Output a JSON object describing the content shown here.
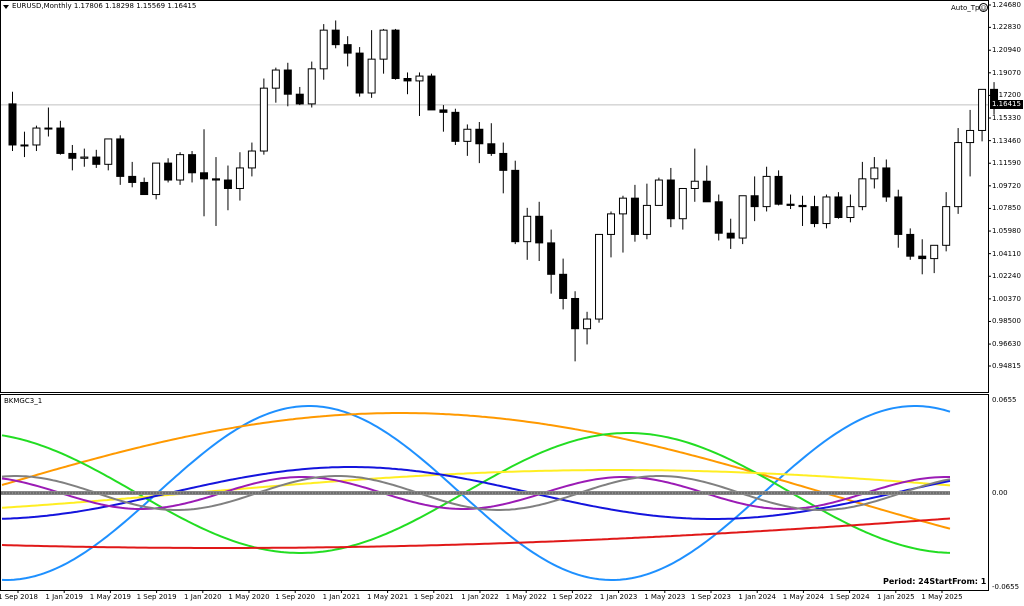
{
  "main_chart": {
    "symbol_info": "EURUSD,Monthly  1.17806 1.18298 1.15569 1.16415",
    "indicator_tag": "Auto_Tp",
    "current_price": "1.16415",
    "price_labels": [
      "1.24680",
      "1.22830",
      "1.20940",
      "1.19070",
      "1.17200",
      "1.15330",
      "1.13460",
      "1.11590",
      "1.09720",
      "1.07850",
      "1.05980",
      "1.04110",
      "1.02240",
      "1.00370",
      "0.98500",
      "0.96630",
      "0.94815"
    ],
    "price_range": [
      0.94815,
      1.2468
    ],
    "candles": [
      [
        1.165,
        1.175,
        1.126,
        1.131
      ],
      [
        1.131,
        1.142,
        1.121,
        1.131
      ],
      [
        1.131,
        1.147,
        1.126,
        1.145
      ],
      [
        1.145,
        1.162,
        1.138,
        1.145
      ],
      [
        1.145,
        1.151,
        1.123,
        1.124
      ],
      [
        1.124,
        1.131,
        1.11,
        1.12
      ],
      [
        1.12,
        1.128,
        1.113,
        1.121
      ],
      [
        1.121,
        1.127,
        1.112,
        1.115
      ],
      [
        1.115,
        1.136,
        1.11,
        1.136
      ],
      [
        1.136,
        1.139,
        1.098,
        1.105
      ],
      [
        1.105,
        1.117,
        1.096,
        1.1
      ],
      [
        1.1,
        1.104,
        1.09,
        1.09
      ],
      [
        1.09,
        1.116,
        1.086,
        1.116
      ],
      [
        1.116,
        1.12,
        1.1,
        1.102
      ],
      [
        1.102,
        1.125,
        1.098,
        1.123
      ],
      [
        1.123,
        1.126,
        1.1,
        1.108
      ],
      [
        1.108,
        1.144,
        1.072,
        1.103
      ],
      [
        1.103,
        1.121,
        1.064,
        1.102
      ],
      [
        1.102,
        1.114,
        1.077,
        1.095
      ],
      [
        1.095,
        1.125,
        1.085,
        1.112
      ],
      [
        1.112,
        1.133,
        1.105,
        1.126
      ],
      [
        1.126,
        1.186,
        1.123,
        1.178
      ],
      [
        1.178,
        1.195,
        1.166,
        1.193
      ],
      [
        1.193,
        1.199,
        1.163,
        1.173
      ],
      [
        1.173,
        1.179,
        1.164,
        1.165
      ],
      [
        1.165,
        1.2,
        1.162,
        1.194
      ],
      [
        1.194,
        1.231,
        1.185,
        1.226
      ],
      [
        1.226,
        1.234,
        1.211,
        1.214
      ],
      [
        1.214,
        1.221,
        1.196,
        1.207
      ],
      [
        1.207,
        1.212,
        1.171,
        1.174
      ],
      [
        1.174,
        1.226,
        1.17,
        1.202
      ],
      [
        1.202,
        1.227,
        1.19,
        1.226
      ],
      [
        1.226,
        1.227,
        1.185,
        1.186
      ],
      [
        1.186,
        1.191,
        1.173,
        1.184
      ],
      [
        1.184,
        1.191,
        1.155,
        1.188
      ],
      [
        1.188,
        1.19,
        1.16,
        1.16
      ],
      [
        1.16,
        1.164,
        1.142,
        1.158
      ],
      [
        1.158,
        1.161,
        1.131,
        1.134
      ],
      [
        1.134,
        1.148,
        1.122,
        1.144
      ],
      [
        1.144,
        1.15,
        1.116,
        1.132
      ],
      [
        1.132,
        1.149,
        1.122,
        1.124
      ],
      [
        1.124,
        1.133,
        1.091,
        1.11
      ],
      [
        1.11,
        1.118,
        1.049,
        1.051
      ],
      [
        1.051,
        1.079,
        1.036,
        1.072
      ],
      [
        1.072,
        1.084,
        1.035,
        1.05
      ],
      [
        1.05,
        1.061,
        1.008,
        1.024
      ],
      [
        1.024,
        1.037,
        0.995,
        1.004
      ],
      [
        1.004,
        1.01,
        0.952,
        0.979
      ],
      [
        0.979,
        0.993,
        0.966,
        0.987
      ],
      [
        0.987,
        1.051,
        0.984,
        1.057
      ],
      [
        1.057,
        1.076,
        1.038,
        1.074
      ],
      [
        1.074,
        1.089,
        1.042,
        1.087
      ],
      [
        1.087,
        1.098,
        1.051,
        1.057
      ],
      [
        1.057,
        1.099,
        1.053,
        1.081
      ],
      [
        1.081,
        1.104,
        1.084,
        1.102
      ],
      [
        1.102,
        1.112,
        1.063,
        1.07
      ],
      [
        1.07,
        1.092,
        1.061,
        1.095
      ],
      [
        1.095,
        1.128,
        1.084,
        1.101
      ],
      [
        1.101,
        1.114,
        1.088,
        1.084
      ],
      [
        1.084,
        1.09,
        1.052,
        1.058
      ],
      [
        1.058,
        1.07,
        1.045,
        1.054
      ],
      [
        1.054,
        1.089,
        1.049,
        1.089
      ],
      [
        1.089,
        1.105,
        1.068,
        1.08
      ],
      [
        1.08,
        1.113,
        1.076,
        1.105
      ],
      [
        1.105,
        1.11,
        1.081,
        1.082
      ],
      [
        1.082,
        1.09,
        1.078,
        1.081
      ],
      [
        1.081,
        1.089,
        1.064,
        1.08
      ],
      [
        1.08,
        1.089,
        1.063,
        1.066
      ],
      [
        1.066,
        1.09,
        1.062,
        1.088
      ],
      [
        1.088,
        1.092,
        1.07,
        1.071
      ],
      [
        1.071,
        1.09,
        1.067,
        1.08
      ],
      [
        1.08,
        1.117,
        1.077,
        1.103
      ],
      [
        1.103,
        1.121,
        1.095,
        1.112
      ],
      [
        1.112,
        1.119,
        1.084,
        1.088
      ],
      [
        1.088,
        1.094,
        1.046,
        1.057
      ],
      [
        1.057,
        1.062,
        1.036,
        1.039
      ],
      [
        1.039,
        1.053,
        1.024,
        1.037
      ],
      [
        1.037,
        1.048,
        1.025,
        1.048
      ],
      [
        1.048,
        1.092,
        1.043,
        1.08
      ],
      [
        1.08,
        1.145,
        1.074,
        1.133
      ],
      [
        1.133,
        1.16,
        1.105,
        1.143
      ],
      [
        1.143,
        1.177,
        1.134,
        1.177
      ],
      [
        1.177,
        1.183,
        1.156,
        1.164
      ]
    ]
  },
  "indicator_panel": {
    "name": "BKMGC3_1",
    "scale_labels": [
      "0.0655",
      "0.00",
      "-0.0655"
    ],
    "footer": "Period: 24StartFrom: 1",
    "colors": [
      "#1e90ff",
      "#ff9900",
      "#22dd22",
      "#ffee22",
      "#e01818",
      "#1414dd",
      "#9b1bb5",
      "#808080"
    ]
  },
  "time_labels": [
    "1 Sep 2018",
    "1 Jan 2019",
    "1 May 2019",
    "1 Sep 2019",
    "1 Jan 2020",
    "1 May 2020",
    "1 Sep 2020",
    "1 Jan 2021",
    "1 May 2021",
    "1 Sep 2021",
    "1 Jan 2022",
    "1 May 2022",
    "1 Sep 2022",
    "1 Jan 2023",
    "1 May 2023",
    "1 Sep 2023",
    "1 Jan 2024",
    "1 May 2024",
    "1 Sep 2024",
    "1 Jan 2025",
    "1 May 2025"
  ]
}
